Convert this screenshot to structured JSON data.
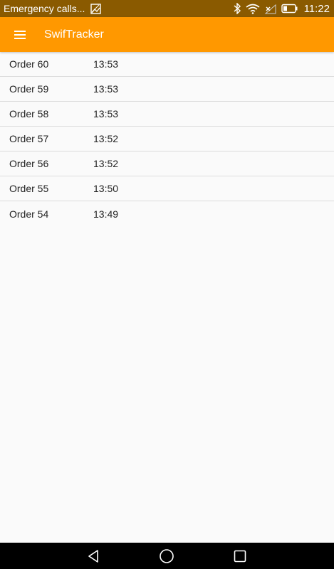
{
  "status_bar": {
    "carrier_text": "Emergency calls...",
    "time": "11:22",
    "icons": [
      "image-notification-icon",
      "bluetooth-icon",
      "wifi-icon",
      "no-signal-icon",
      "battery-icon"
    ]
  },
  "app_bar": {
    "title": "SwifTracker",
    "menu_icon": "hamburger-menu-icon",
    "color": "#ff9800"
  },
  "orders": [
    {
      "name": "Order 60",
      "time": "13:53"
    },
    {
      "name": "Order 59",
      "time": "13:53"
    },
    {
      "name": "Order 58",
      "time": "13:53"
    },
    {
      "name": "Order 57",
      "time": "13:52"
    },
    {
      "name": "Order 56",
      "time": "13:52"
    },
    {
      "name": "Order 55",
      "time": "13:50"
    },
    {
      "name": "Order 54",
      "time": "13:49"
    }
  ],
  "nav_bar": {
    "icons": [
      "back-icon",
      "home-icon",
      "recents-icon"
    ]
  }
}
